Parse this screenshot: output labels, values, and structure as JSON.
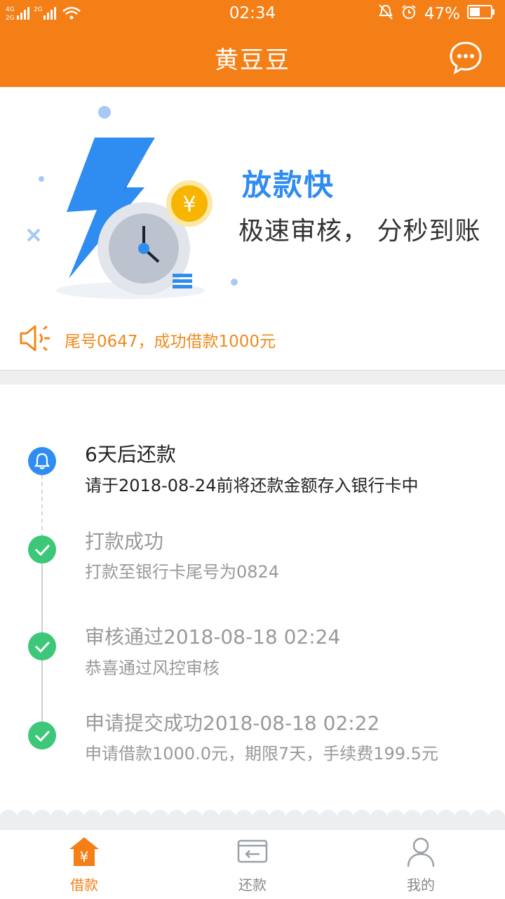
{
  "status_bar": {
    "network_left": "4G 2G",
    "network_right": "2G",
    "time": "02:34",
    "battery_pct": "47%",
    "icons": [
      "signal-icon",
      "wifi-icon",
      "mute-icon",
      "alarm-icon",
      "battery-icon"
    ]
  },
  "header": {
    "title": "黄豆豆",
    "chat_icon": "chat-bubble-icon"
  },
  "banner": {
    "headline": "放款快",
    "subtitle": "极速审核， 分秒到账",
    "coin_symbol": "¥",
    "notice_text": "尾号0647，成功借款1000元"
  },
  "timeline": [
    {
      "title": "6天后还款",
      "desc": "请于2018-08-24前将还款金额存入银行卡中",
      "state": "pending"
    },
    {
      "title": "打款成功",
      "desc": "打款至银行卡尾号为0824",
      "state": "done"
    },
    {
      "title": "审核通过2018-08-18 02:24",
      "desc": "恭喜通过风控审核",
      "state": "done"
    },
    {
      "title": "申请提交成功2018-08-18 02:22",
      "desc": "申请借款1000.0元，期限7天，手续费199.5元",
      "state": "done"
    }
  ],
  "tabs": [
    {
      "label": "借款",
      "icon": "home-yuan-icon",
      "active": true
    },
    {
      "label": "还款",
      "icon": "repay-card-icon",
      "active": false
    },
    {
      "label": "我的",
      "icon": "user-icon",
      "active": false
    }
  ],
  "colors": {
    "brand": "#f57f17",
    "blue": "#2f8cf0",
    "green": "#3cc878",
    "notice": "#f08a1c"
  }
}
